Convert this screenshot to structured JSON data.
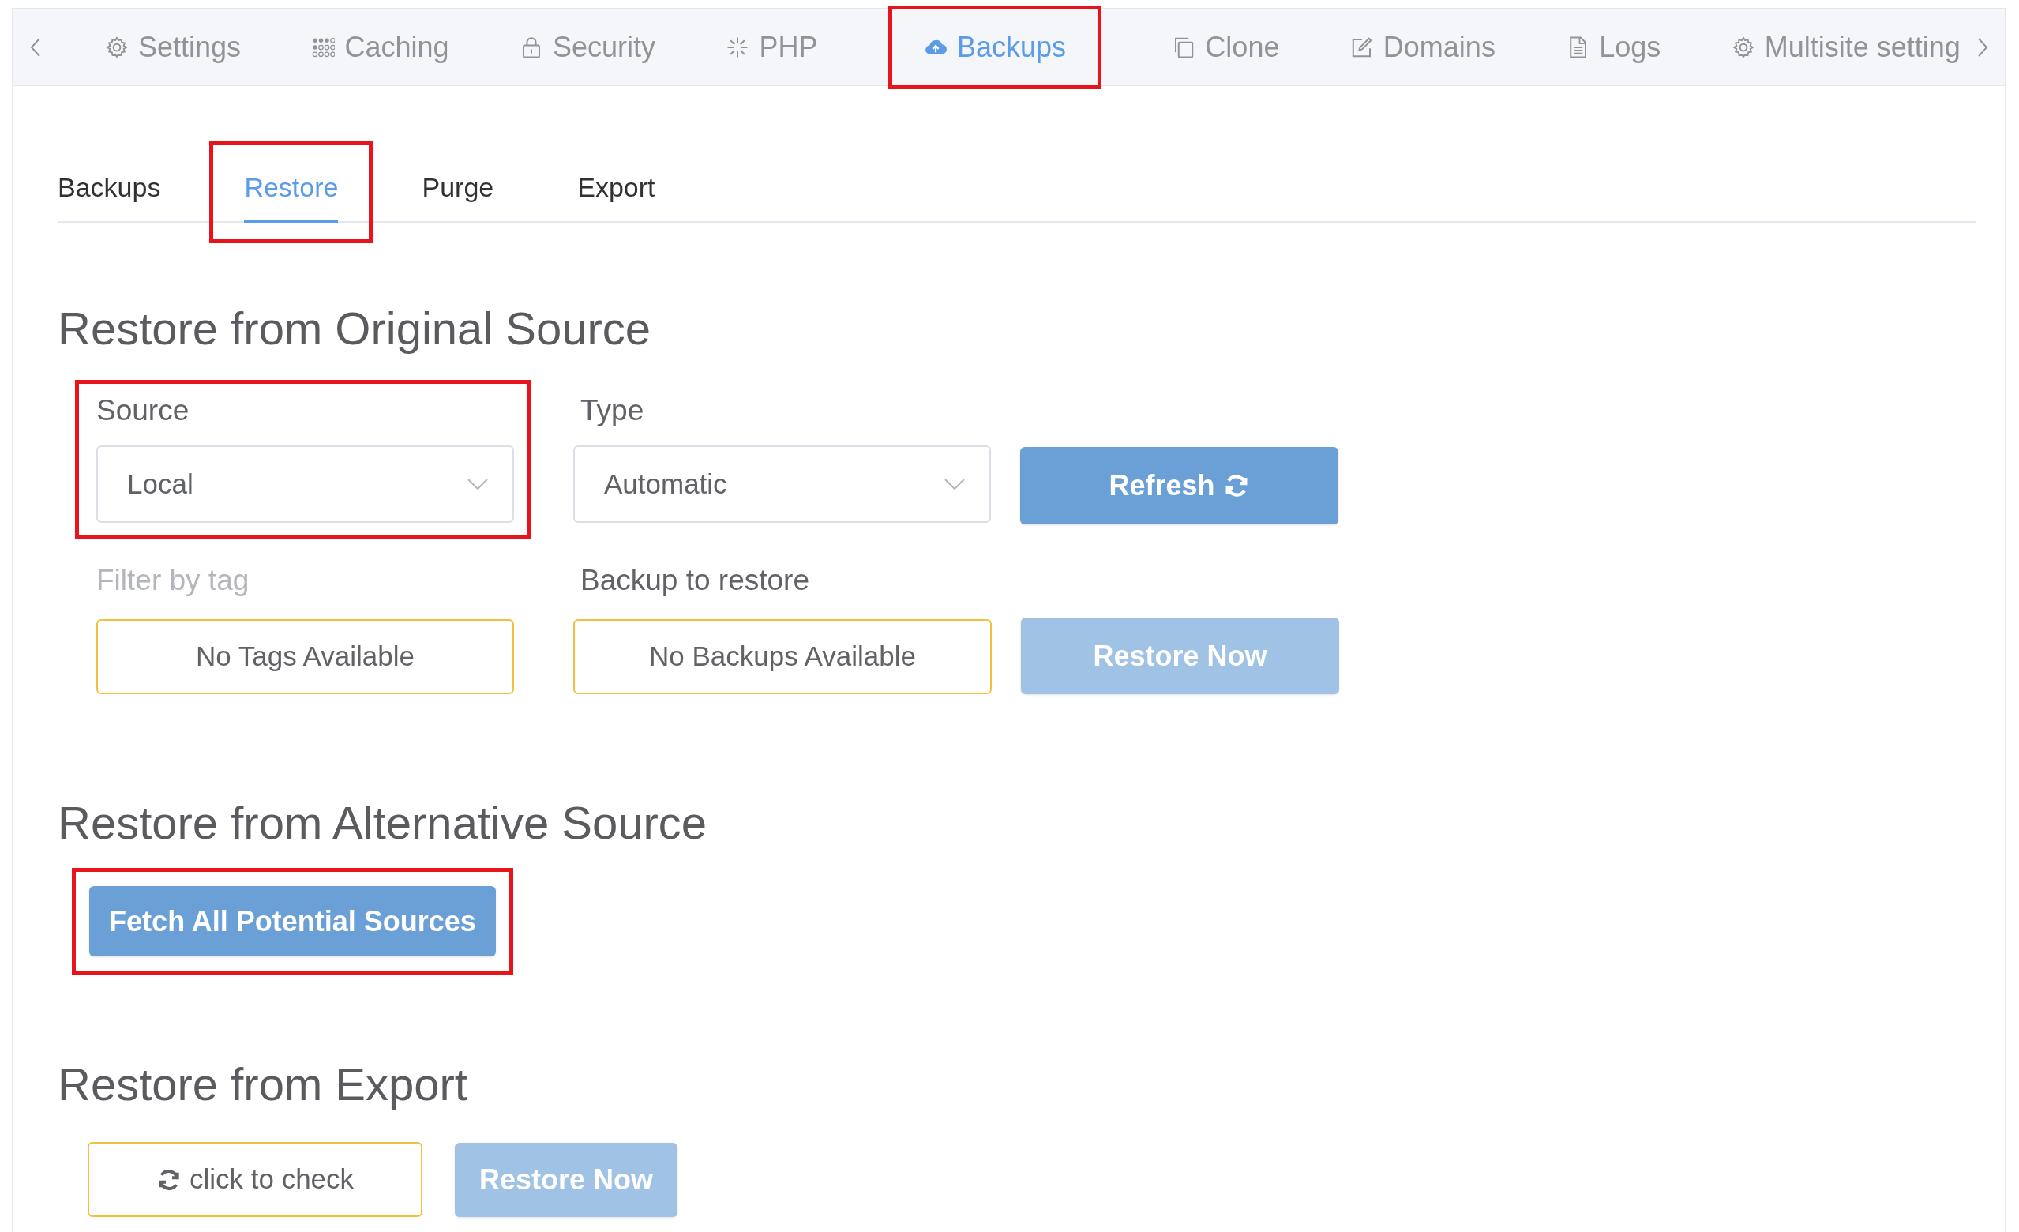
{
  "top_tabs": [
    {
      "label": "Settings",
      "kind": "gear",
      "selected": false,
      "highlighted": false
    },
    {
      "label": "Caching",
      "kind": "dots",
      "selected": false,
      "highlighted": false
    },
    {
      "label": "Security",
      "kind": "lock",
      "selected": false,
      "highlighted": false
    },
    {
      "label": "PHP",
      "kind": "sparkle",
      "selected": false,
      "highlighted": false
    },
    {
      "label": "Backups",
      "kind": "cloud",
      "selected": true,
      "highlighted": true
    },
    {
      "label": "Clone",
      "kind": "copy",
      "selected": false,
      "highlighted": false
    },
    {
      "label": "Domains",
      "kind": "edit",
      "selected": false,
      "highlighted": false
    },
    {
      "label": "Logs",
      "kind": "document",
      "selected": false,
      "highlighted": false
    },
    {
      "label": "Multisite setting",
      "kind": "gear",
      "selected": false,
      "highlighted": false
    }
  ],
  "sub_tabs": [
    {
      "label": "Backups",
      "selected": false,
      "highlighted": false
    },
    {
      "label": "Restore",
      "selected": true,
      "highlighted": true
    },
    {
      "label": "Purge",
      "selected": false,
      "highlighted": false
    },
    {
      "label": "Export",
      "selected": false,
      "highlighted": false
    }
  ],
  "original_source": {
    "title": "Restore from Original Source",
    "source": {
      "label": "Source",
      "value": "Local",
      "highlighted": true
    },
    "type": {
      "label": "Type",
      "value": "Automatic"
    },
    "refresh_button": {
      "label": "Refresh",
      "disabled": false
    },
    "filter": {
      "label": "Filter by tag",
      "value": "No Tags Available",
      "disabled": true
    },
    "backup": {
      "label": "Backup to restore",
      "value": "No Backups Available",
      "disabled": false
    },
    "restore_button": {
      "label": "Restore Now",
      "disabled": true
    }
  },
  "alternative_source": {
    "title": "Restore from Alternative Source",
    "fetch_button": {
      "label": "Fetch All Potential Sources",
      "highlighted": true,
      "disabled": false
    }
  },
  "export": {
    "title": "Restore from Export",
    "check_button": {
      "label": "click to check"
    },
    "restore_button": {
      "label": "Restore Now",
      "disabled": true
    }
  }
}
